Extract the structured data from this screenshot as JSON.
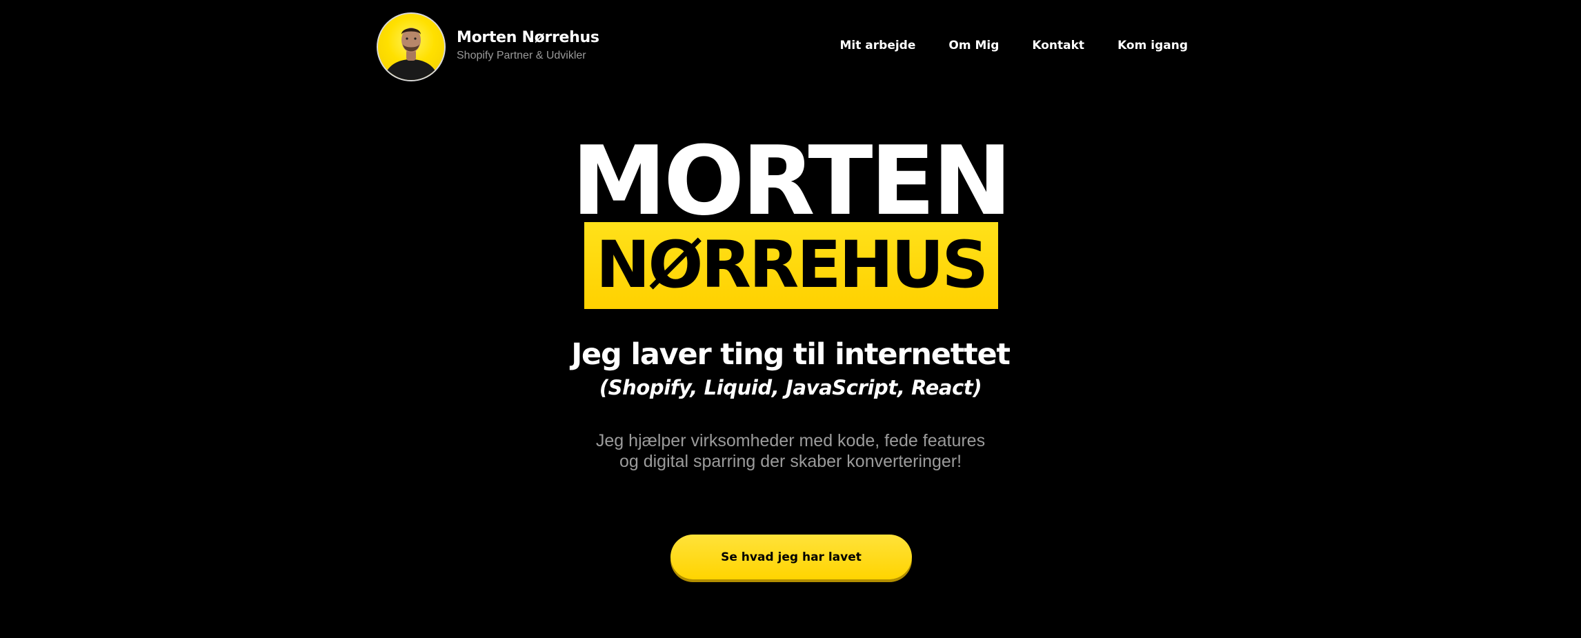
{
  "header": {
    "name": "Morten Nørrehus",
    "subtitle": "Shopify Partner & Udvikler",
    "nav": [
      {
        "label": "Mit arbejde"
      },
      {
        "label": "Om Mig"
      },
      {
        "label": "Kontakt"
      },
      {
        "label": "Kom igang"
      }
    ]
  },
  "hero": {
    "first_name": "MORTEN",
    "last_name": "NØRREHUS",
    "tagline": "Jeg laver ting til internettet",
    "tech": "(Shopify, Liquid, JavaScript, React)",
    "description_lines": [
      "Jeg hjælper virksomheder med kode, fede features",
      "og digital sparring der skaber konverteringer!"
    ],
    "cta_label": "Se hvad jeg har lavet"
  },
  "colors": {
    "background": "#000000",
    "accent": "#ffd80a",
    "text": "#ffffff",
    "muted": "#9b9b9b"
  }
}
